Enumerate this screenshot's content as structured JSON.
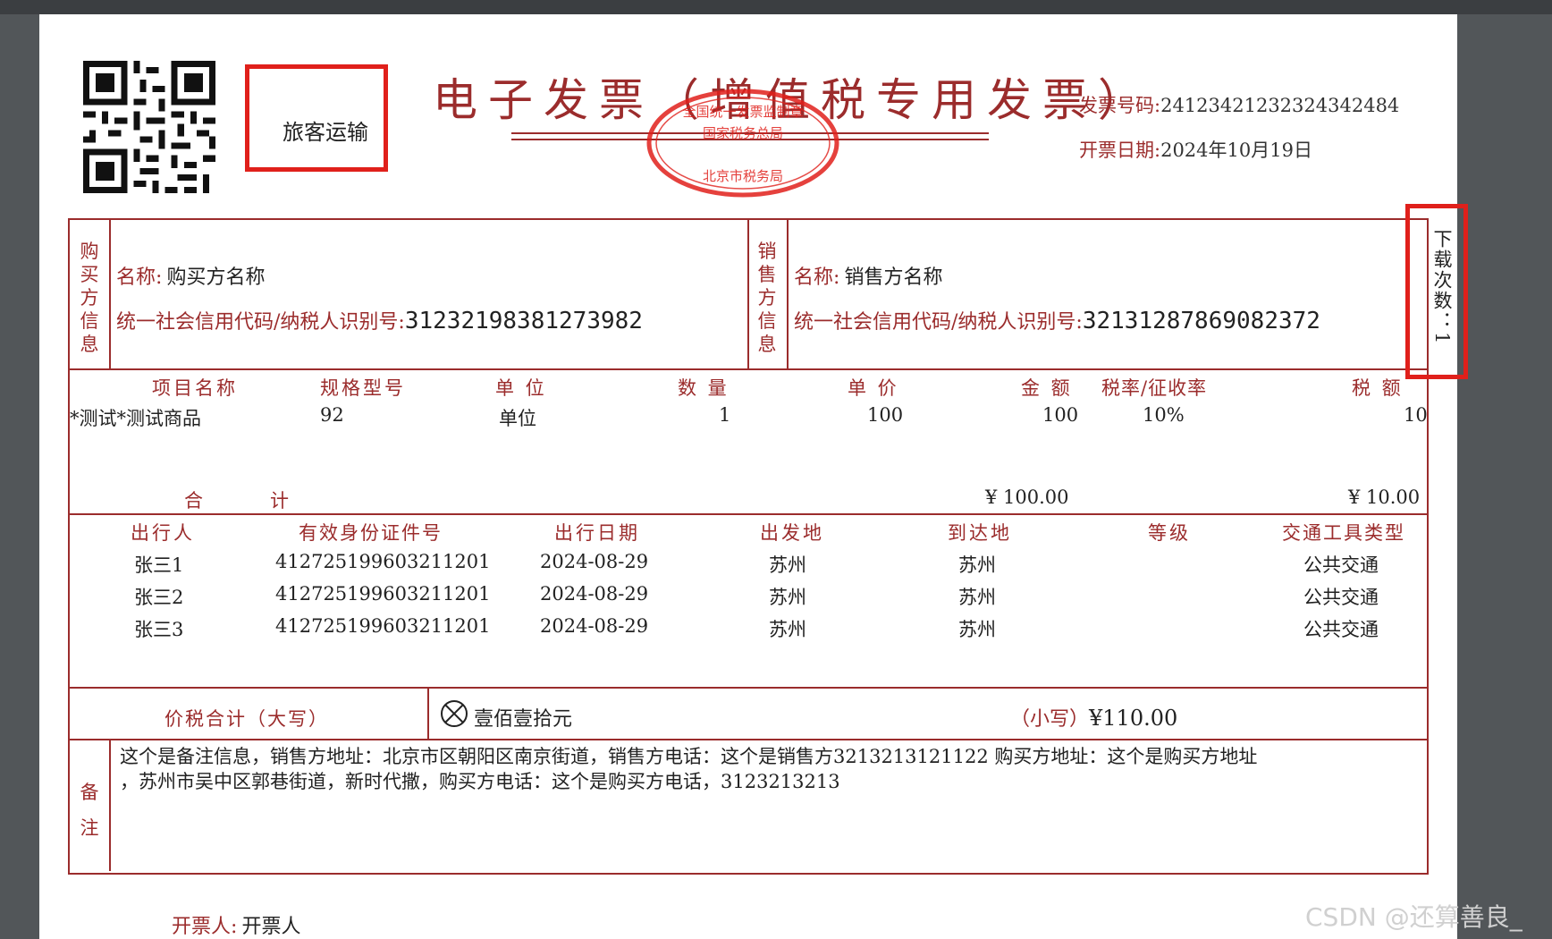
{
  "invoice": {
    "title": "电子发票（增值税专用发票）",
    "category_box": "旅客运输",
    "number_label": "发票号码:",
    "number": "24123421232324342484",
    "date_label": "开票日期:",
    "date": "2024年10月19日",
    "seal_text": [
      "全国统一发票监制章",
      "国家税务总局",
      "北京市税务局"
    ],
    "download_count_label": "下载次数：1"
  },
  "buyer": {
    "section_label": "购买方信息",
    "name_label": "名称:",
    "name": "购买方名称",
    "tax_id_label": "统一社会信用代码/纳税人识别号:",
    "tax_id": "31232198381273982"
  },
  "seller": {
    "section_label": "销售方信息",
    "name_label": "名称:",
    "name": "销售方名称",
    "tax_id_label": "统一社会信用代码/纳税人识别号:",
    "tax_id": "32131287869082372"
  },
  "items": {
    "headers": [
      "项目名称",
      "规格型号",
      "单 位",
      "数 量",
      "单 价",
      "金 额",
      "税率/征收率",
      "税 额"
    ],
    "rows": [
      {
        "name": "*测试*测试商品",
        "spec": "92",
        "unit": "单位",
        "qty": "1",
        "price": "100",
        "amount": "100",
        "rate": "10%",
        "tax": "10"
      }
    ],
    "total_label": "合　　　计",
    "total_amount": "¥ 100.00",
    "total_tax": "¥ 10.00"
  },
  "travel": {
    "headers": [
      "出行人",
      "有效身份证件号",
      "出行日期",
      "出发地",
      "到达地",
      "等级",
      "交通工具类型"
    ],
    "rows": [
      {
        "traveler": "张三1",
        "id": "412725199603211201",
        "date": "2024-08-29",
        "from": "苏州",
        "to": "苏州",
        "level": "",
        "vehicle": "公共交通"
      },
      {
        "traveler": "张三2",
        "id": "412725199603211201",
        "date": "2024-08-29",
        "from": "苏州",
        "to": "苏州",
        "level": "",
        "vehicle": "公共交通"
      },
      {
        "traveler": "张三3",
        "id": "412725199603211201",
        "date": "2024-08-29",
        "from": "苏州",
        "to": "苏州",
        "level": "",
        "vehicle": "公共交通"
      }
    ]
  },
  "total": {
    "label": "价税合计（大写）",
    "uppercase": "壹佰壹拾元",
    "lowercase_label": "（小写）",
    "lowercase": "¥110.00"
  },
  "remarks": {
    "label": "备注",
    "line1": "这个是备注信息，销售方地址：北京市区朝阳区南京街道，销售方电话：这个是销售方3213213121122 购买方地址：这个是购买方地址",
    "line2": "，苏州市吴中区郭巷街道，新时代撒，购买方电话：这个是购买方电话，3123213213"
  },
  "issuer": {
    "label": "开票人:",
    "name": "开票人"
  },
  "watermark": "CSDN @还算善良_",
  "colors": {
    "accent": "#9b2c2c",
    "highlight": "#e0201b",
    "seal": "#e0201b"
  }
}
